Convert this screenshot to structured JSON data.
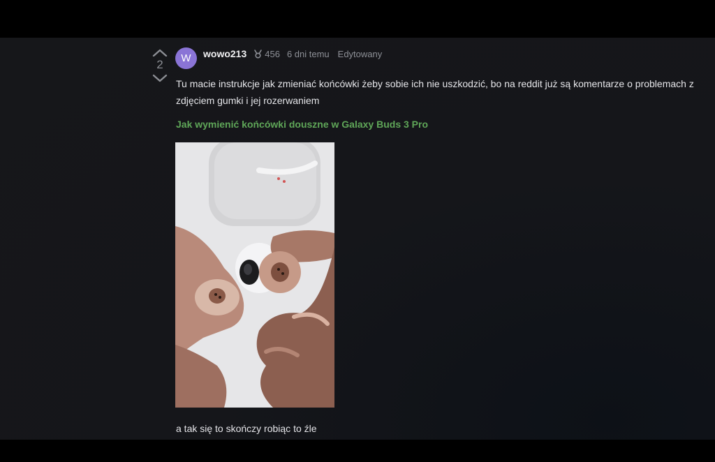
{
  "comment": {
    "votes": "2",
    "avatar_letter": "W",
    "username": "wowo213",
    "badge_count": "456",
    "timestamp": "6 dni temu",
    "edited": "Edytowany",
    "body": "Tu macie instrukcje jak zmieniać końcówki żeby sobie ich nie uszkodzić, bo na reddit już są komentarze o problemach z zdjęciem gumki i jej rozerwaniem",
    "link_text": "Jak wymienić końcówki douszne w Galaxy Buds 3 Pro",
    "footer": "a tak się to skończy robiąc to źle"
  },
  "icons": {
    "upvote": "upvote-icon",
    "downvote": "downvote-icon",
    "badge": "medal-icon"
  },
  "colors": {
    "background": "#16171a",
    "avatar": "#8a74d6",
    "link": "#5fa658",
    "muted": "#8e9097"
  }
}
